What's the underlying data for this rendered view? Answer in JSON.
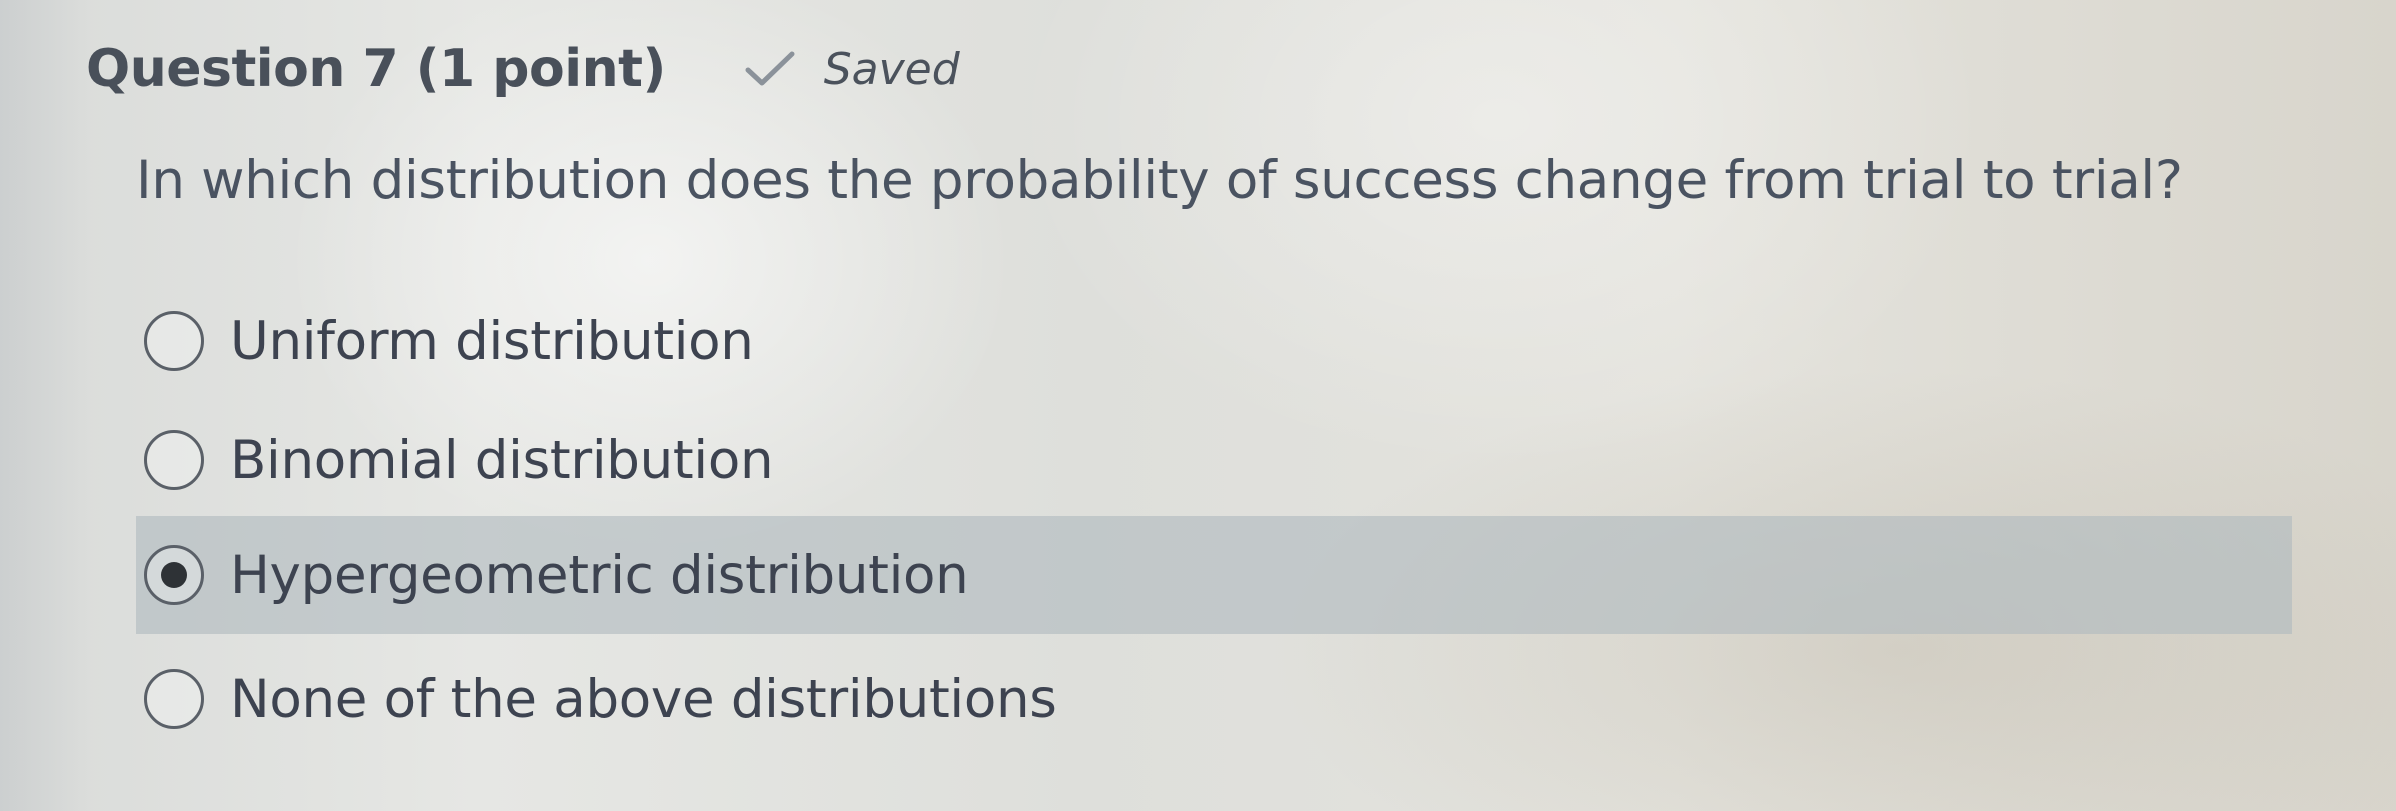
{
  "question": {
    "title": "Question 7 (1 point)",
    "status": "Saved",
    "status_icon": "checkmark-icon",
    "text": "In which distribution does the probability of success change from trial to trial?"
  },
  "options": [
    {
      "label": "Uniform distribution",
      "selected": false
    },
    {
      "label": "Binomial distribution",
      "selected": false
    },
    {
      "label": "Hypergeometric distribution",
      "selected": true
    },
    {
      "label": "None of the above distributions",
      "selected": false
    }
  ],
  "colors": {
    "selected_highlight": "#b0b9be",
    "text": "#3d4350"
  }
}
